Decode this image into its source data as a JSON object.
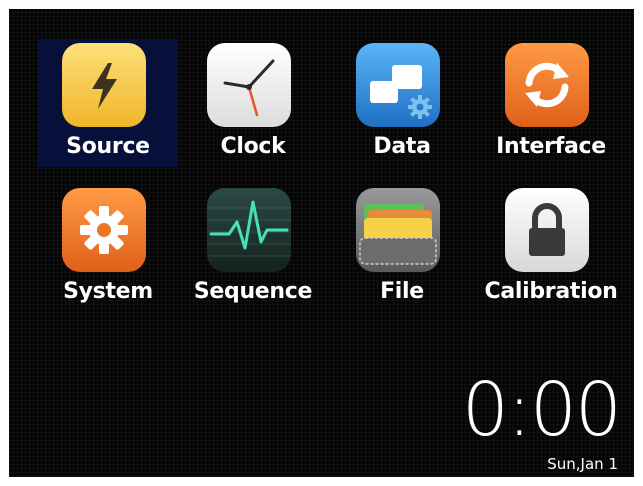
{
  "apps": [
    {
      "label": "Source",
      "icon": "lightning-bolt-icon",
      "color": "#f5c542",
      "selected": true
    },
    {
      "label": "Clock",
      "icon": "clock-icon",
      "color": "#f2f2f2",
      "selected": false
    },
    {
      "label": "Data",
      "icon": "data-transfer-icon",
      "color": "#2f8ee0",
      "selected": false
    },
    {
      "label": "Interface",
      "icon": "sync-icon",
      "color": "#f07a1e",
      "selected": false
    },
    {
      "label": "System",
      "icon": "gear-icon",
      "color": "#f07a1e",
      "selected": false
    },
    {
      "label": "Sequence",
      "icon": "waveform-icon",
      "color": "#1f3a35",
      "selected": false
    },
    {
      "label": "File",
      "icon": "folder-icon",
      "color": "#7a7a7a",
      "selected": false
    },
    {
      "label": "Calibration",
      "icon": "lock-icon",
      "color": "#ececec",
      "selected": false
    }
  ],
  "status": {
    "time": "0:00",
    "date": "Sun,Jan 1"
  }
}
